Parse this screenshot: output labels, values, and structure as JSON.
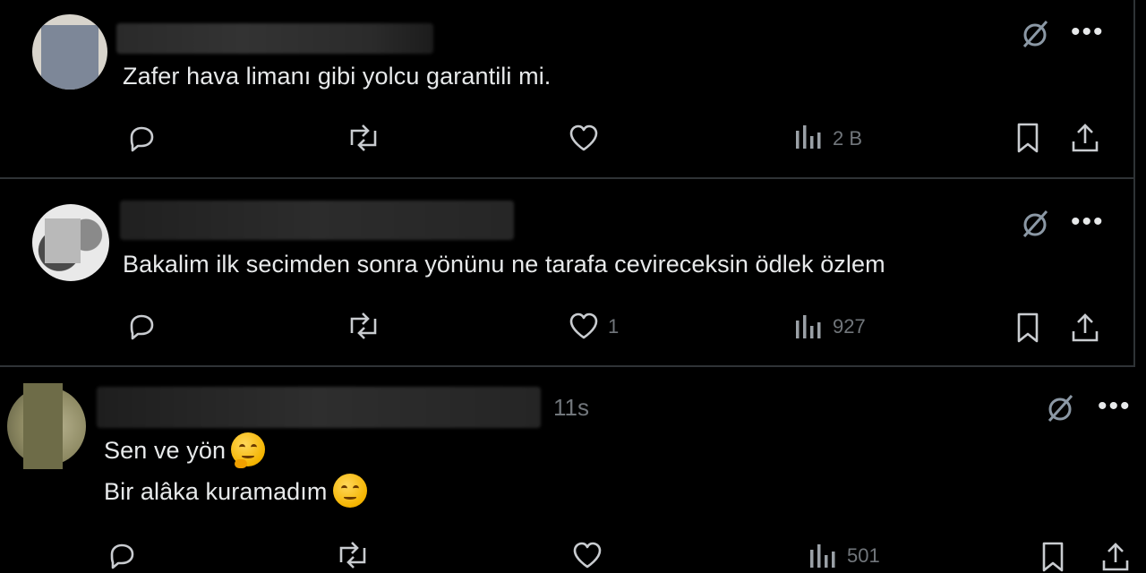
{
  "tweets": [
    {
      "text": "Zafer hava limanı gibi yolcu garantili mi.",
      "time": "",
      "likes": "",
      "views": "2 B"
    },
    {
      "text": "Bakalim ilk secimden sonra yönünu ne tarafa cevireceksin ödlek özlem",
      "time": "",
      "likes": "1",
      "views": "927"
    },
    {
      "line1": "Sen ve yön",
      "line2": "Bir alâka kuramadım",
      "time": "11s",
      "likes": "",
      "views": "501"
    }
  ],
  "icons": {
    "reply": "reply-icon",
    "retweet": "retweet-icon",
    "like": "like-icon",
    "views": "views-icon",
    "bookmark": "bookmark-icon",
    "share": "share-icon",
    "grok": "grok-icon",
    "more": "more-icon"
  },
  "more_label": "•••"
}
